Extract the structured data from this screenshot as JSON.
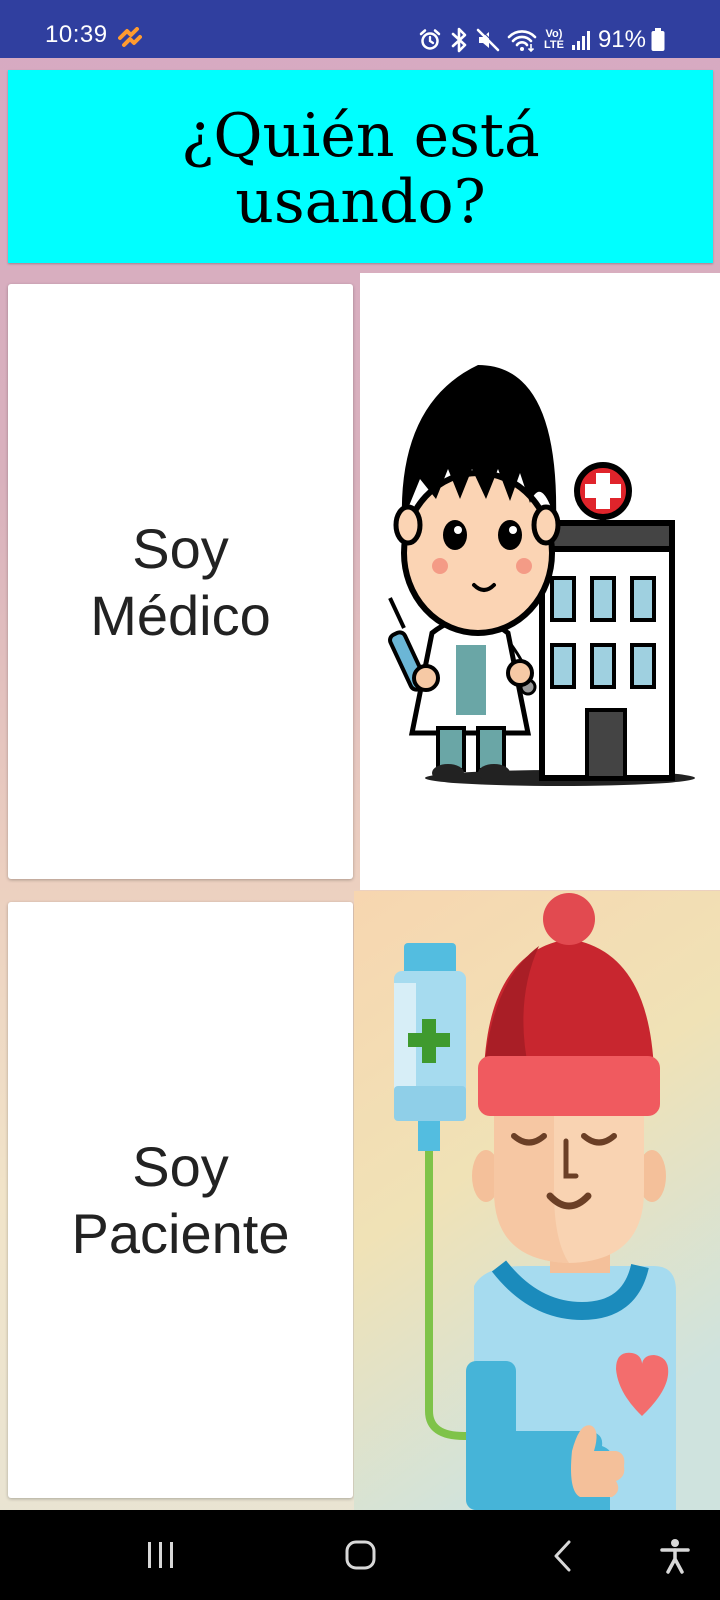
{
  "status_bar": {
    "time": "10:39",
    "battery": "91%",
    "network_badge_top": "Vo)",
    "network_badge_bottom": "LTE",
    "background": "#303f9f"
  },
  "header": {
    "title": "¿Quién está usando?",
    "background": "#00ffff"
  },
  "options": [
    {
      "label": "Soy\nMédico"
    },
    {
      "label": "Soy\nPaciente"
    }
  ],
  "icons": {
    "status_left": [
      "notification-icon"
    ],
    "status_right": [
      "alarm-icon",
      "bluetooth-icon",
      "mute-icon",
      "wifi-icon",
      "volte-icon",
      "signal-icon",
      "battery-icon"
    ],
    "nav": [
      "recents-icon",
      "home-icon",
      "back-icon",
      "accessibility-icon"
    ]
  }
}
